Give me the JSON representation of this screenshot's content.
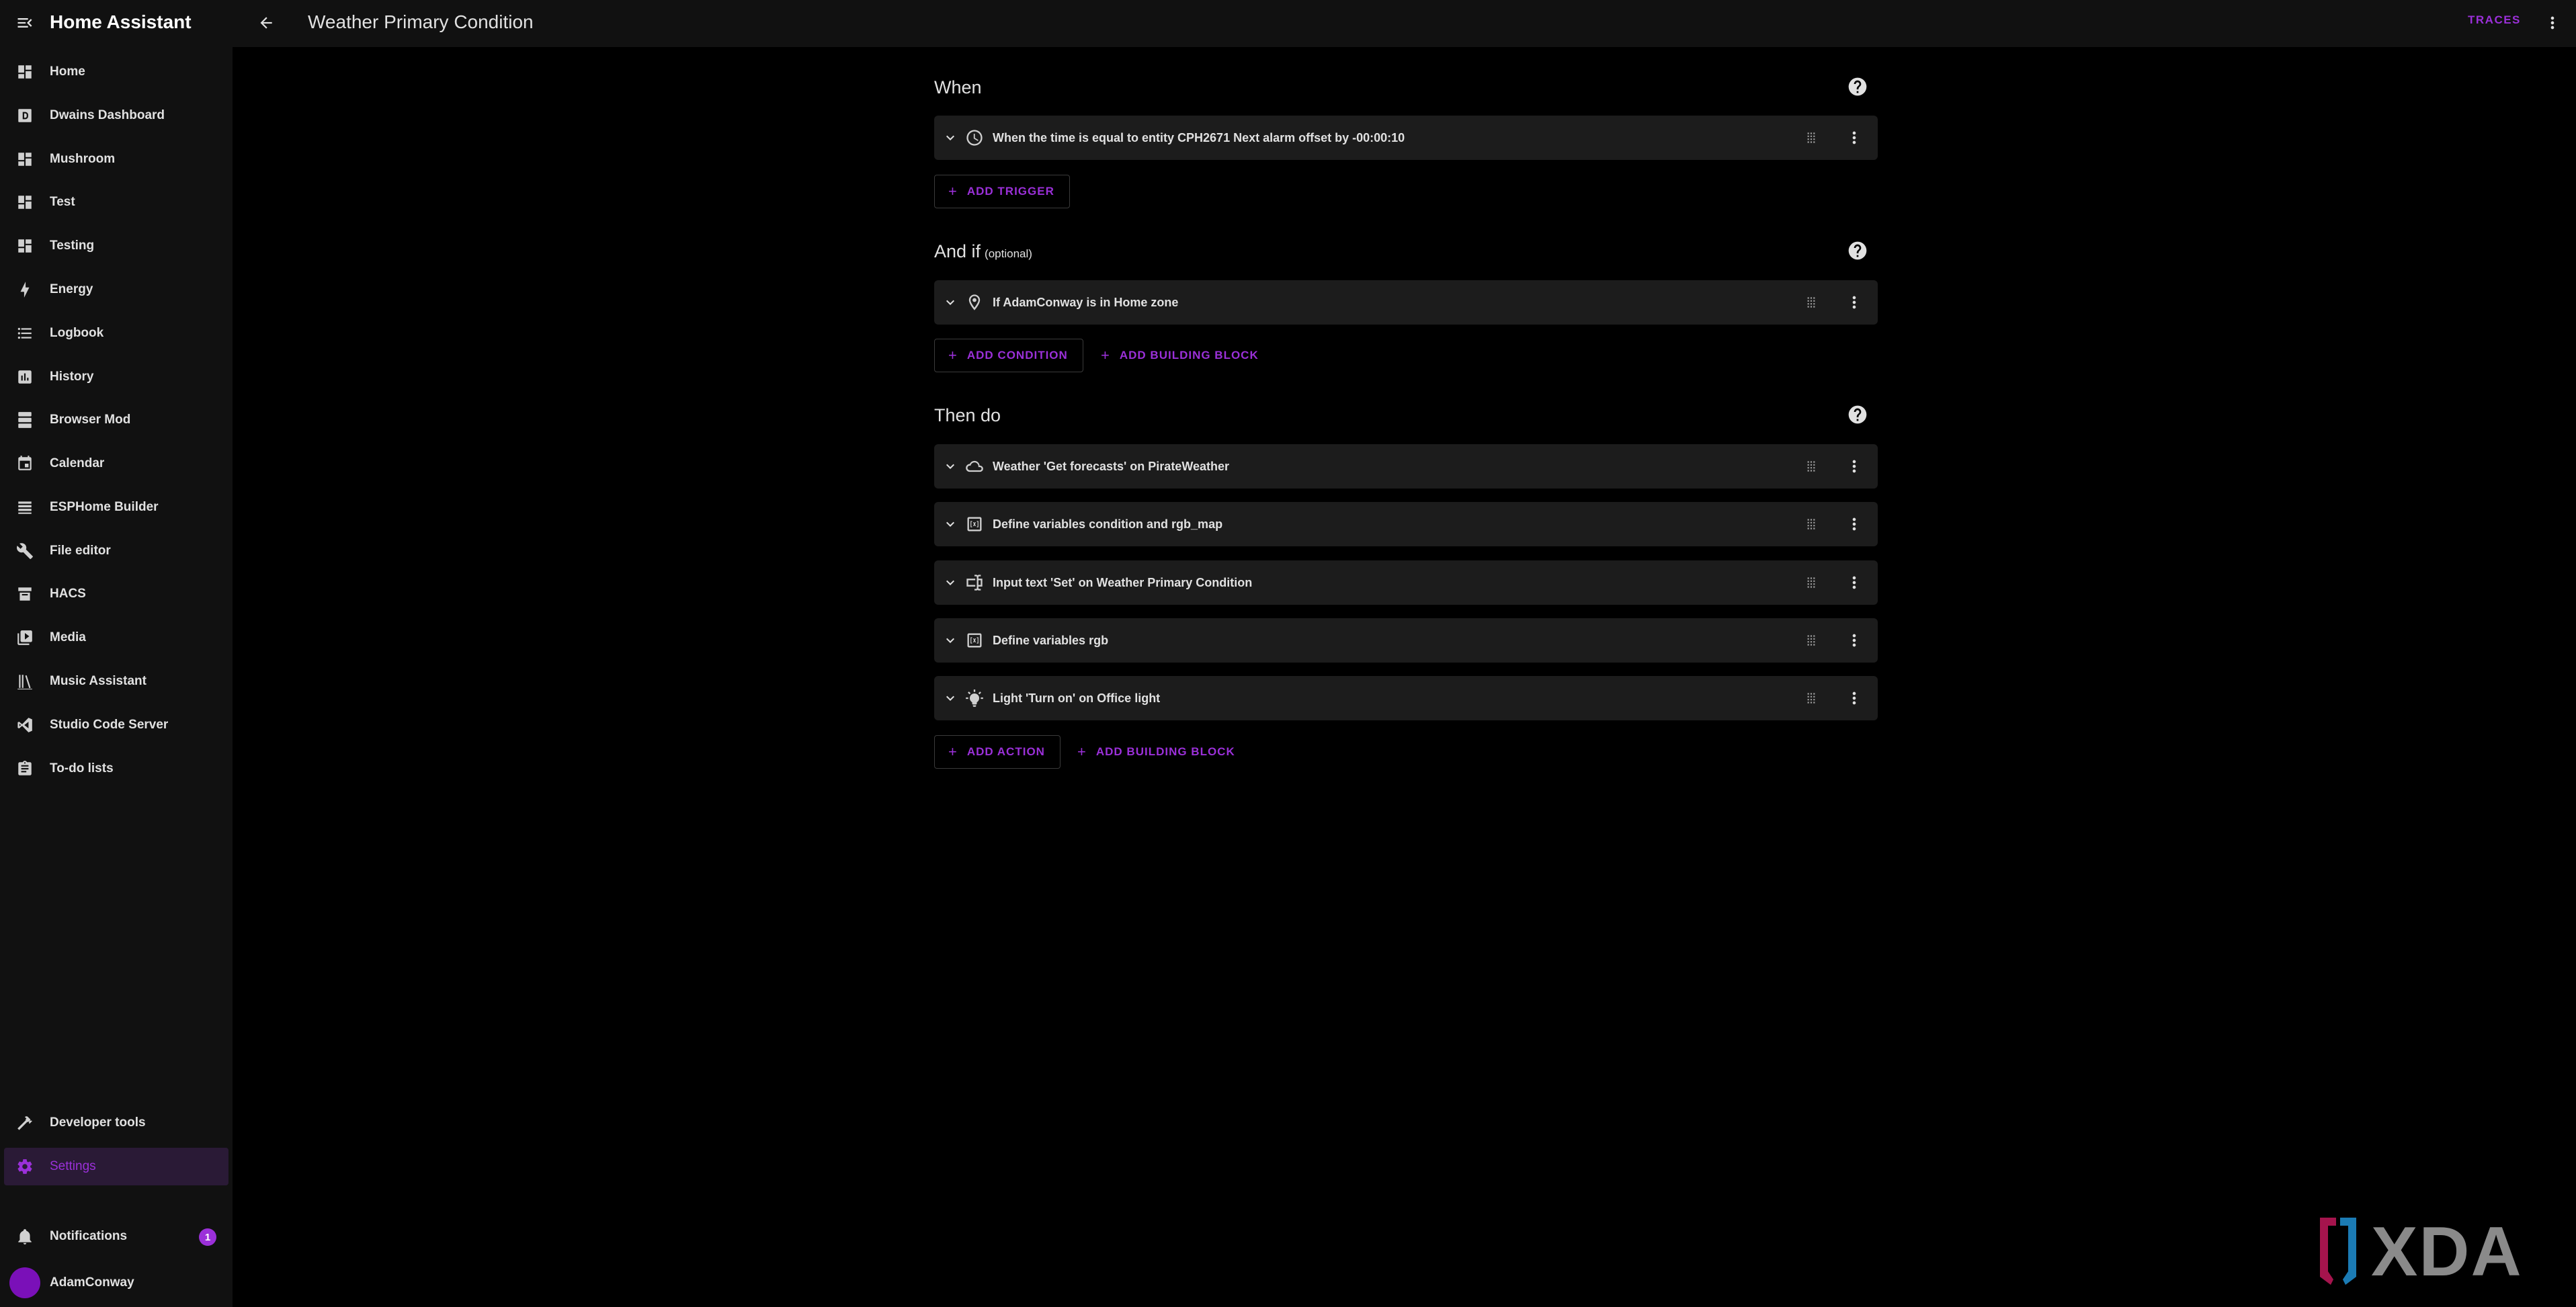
{
  "app": {
    "title": "Home Assistant"
  },
  "header": {
    "title": "Weather Primary Condition",
    "traces_label": "TRACES"
  },
  "sidebar": {
    "items": [
      {
        "label": "Home",
        "icon": "dashboard-icon"
      },
      {
        "label": "Dwains Dashboard",
        "icon": "dashboard-d-icon"
      },
      {
        "label": "Mushroom",
        "icon": "dashboard-icon"
      },
      {
        "label": "Test",
        "icon": "dashboard-icon"
      },
      {
        "label": "Testing",
        "icon": "dashboard-icon"
      },
      {
        "label": "Energy",
        "icon": "lightning-icon"
      },
      {
        "label": "Logbook",
        "icon": "list-icon"
      },
      {
        "label": "History",
        "icon": "chart-box-icon"
      },
      {
        "label": "Browser Mod",
        "icon": "server-icon"
      },
      {
        "label": "Calendar",
        "icon": "calendar-icon"
      },
      {
        "label": "ESPHome Builder",
        "icon": "layers-icon"
      },
      {
        "label": "File editor",
        "icon": "wrench-icon"
      },
      {
        "label": "HACS",
        "icon": "hacs-icon"
      },
      {
        "label": "Media",
        "icon": "play-box-icon"
      },
      {
        "label": "Music Assistant",
        "icon": "library-icon"
      },
      {
        "label": "Studio Code Server",
        "icon": "vscode-icon"
      },
      {
        "label": "To-do lists",
        "icon": "clipboard-list-icon"
      }
    ],
    "developer_tools": "Developer tools",
    "settings": "Settings",
    "notifications": {
      "label": "Notifications",
      "count": "1"
    },
    "user": "AdamConway"
  },
  "when": {
    "title": "When",
    "triggers": [
      {
        "label": "When the time is equal to entity CPH2671 Next alarm offset by -00:00:10",
        "icon": "clock-icon"
      }
    ],
    "add_trigger": "ADD TRIGGER"
  },
  "and_if": {
    "title": "And if",
    "optional": "(optional)",
    "conditions": [
      {
        "label": "If AdamConway is in Home zone",
        "icon": "map-marker-icon"
      }
    ],
    "add_condition": "ADD CONDITION",
    "add_building_block": "ADD BUILDING BLOCK"
  },
  "then_do": {
    "title": "Then do",
    "actions": [
      {
        "label": "Weather 'Get forecasts' on PirateWeather",
        "icon": "weather-cloud-icon"
      },
      {
        "label": "Define variables condition and rgb_map",
        "icon": "variable-box-icon"
      },
      {
        "label": "Input text 'Set' on Weather Primary Condition",
        "icon": "form-textbox-icon"
      },
      {
        "label": "Define variables rgb",
        "icon": "variable-box-icon"
      },
      {
        "label": "Light 'Turn on' on Office light",
        "icon": "lightbulb-icon"
      }
    ],
    "add_action": "ADD ACTION",
    "add_building_block": "ADD BUILDING BLOCK"
  },
  "colors": {
    "accent": "#9b30d9",
    "background": "#000000",
    "surface": "#111111",
    "card": "#1c1c1c",
    "text": "#e1e1e1"
  },
  "watermark": {
    "text": "XDA"
  }
}
